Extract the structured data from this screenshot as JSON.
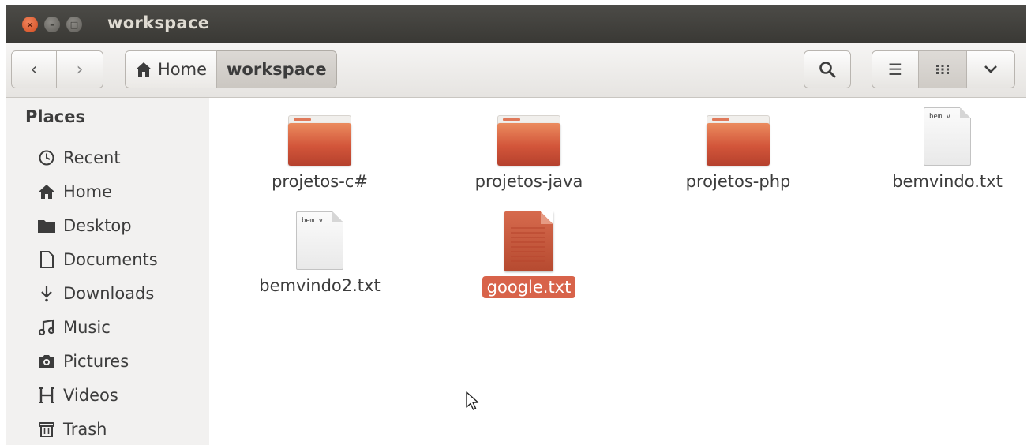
{
  "window": {
    "title": "workspace",
    "controls": {
      "close": "×",
      "minimize": "–",
      "maximize": "□"
    }
  },
  "toolbar": {
    "back_icon": "‹",
    "forward_icon": "›",
    "breadcrumbs": [
      {
        "label": "Home",
        "icon": "home-icon"
      },
      {
        "label": "workspace"
      }
    ],
    "search_icon": "magnifier",
    "view_list_icon": "☰",
    "view_grid_icon": "⋮⋮⋮",
    "view_more_icon": "⌄"
  },
  "sidebar": {
    "heading": "Places",
    "items": [
      {
        "label": "Recent",
        "icon": "clock-icon",
        "glyph": "◷"
      },
      {
        "label": "Home",
        "icon": "home-icon",
        "glyph": "⌂"
      },
      {
        "label": "Desktop",
        "icon": "folder-icon",
        "glyph": "▆"
      },
      {
        "label": "Documents",
        "icon": "document-icon",
        "glyph": "▯"
      },
      {
        "label": "Downloads",
        "icon": "download-icon",
        "glyph": "⇣"
      },
      {
        "label": "Music",
        "icon": "music-icon",
        "glyph": "♫"
      },
      {
        "label": "Pictures",
        "icon": "camera-icon",
        "glyph": "◙"
      },
      {
        "label": "Videos",
        "icon": "film-icon",
        "glyph": "▥"
      },
      {
        "label": "Trash",
        "icon": "trash-icon",
        "glyph": "▣"
      }
    ]
  },
  "files": [
    {
      "name": "projetos-c#",
      "kind": "folder"
    },
    {
      "name": "projetos-java",
      "kind": "folder"
    },
    {
      "name": "projetos-php",
      "kind": "folder"
    },
    {
      "name": "bemvindo.txt",
      "kind": "text",
      "preview": "bem v"
    },
    {
      "name": "bemvindo2.txt",
      "kind": "text",
      "preview": "bem v"
    },
    {
      "name": "google.txt",
      "kind": "html",
      "selected": true
    }
  ],
  "colors": {
    "selection": "#d8634a",
    "folder": "#d2553a",
    "titlebar": "#3a3935"
  }
}
